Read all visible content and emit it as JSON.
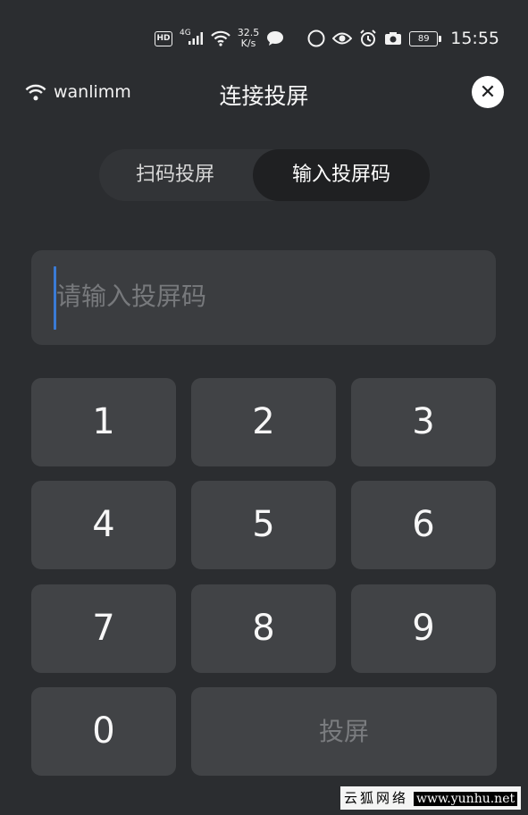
{
  "status_bar": {
    "hd": "HD",
    "network": "4G",
    "speed_value": "32.5",
    "speed_unit": "K/s",
    "nfc_label": "N",
    "battery": "89",
    "time": "15:55"
  },
  "header": {
    "wifi_name": "wanlimm",
    "title": "连接投屏",
    "close_glyph": "✕"
  },
  "tabs": [
    {
      "label": "扫码投屏",
      "selected": false
    },
    {
      "label": "输入投屏码",
      "selected": true
    }
  ],
  "input": {
    "value": "",
    "placeholder": "请输入投屏码"
  },
  "keypad": {
    "keys": [
      "1",
      "2",
      "3",
      "4",
      "5",
      "6",
      "7",
      "8",
      "9",
      "0"
    ],
    "cast_label": "投屏"
  },
  "watermark": {
    "cn": "云狐网络",
    "url": "www.yunhu.net"
  },
  "colors": {
    "background": "#2b2d30",
    "key": "#414346",
    "caret": "#3a7bd5",
    "text": "#ffffff",
    "placeholder": "#77797c"
  }
}
